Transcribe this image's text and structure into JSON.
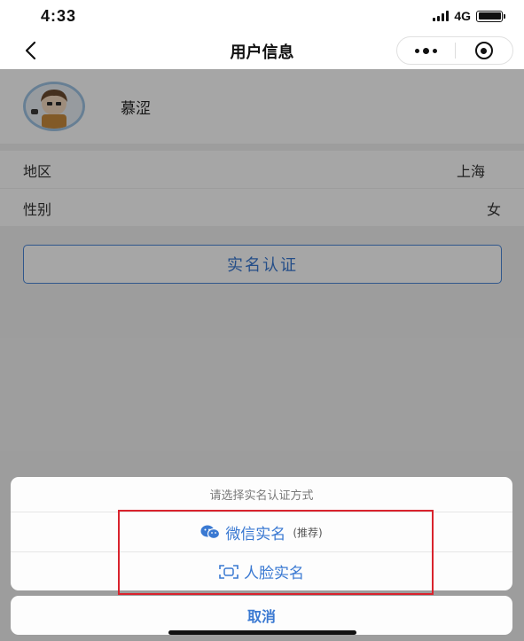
{
  "status_bar": {
    "time": "4:33",
    "network": "4G",
    "battery_level": 1.0
  },
  "nav": {
    "title": "用户信息",
    "back_icon": "chevron-left-icon",
    "more_icon": "more-dots-icon",
    "close_icon": "target-circle-icon"
  },
  "profile": {
    "nickname": "慕涩",
    "avatar_icon": "cartoon-avatar"
  },
  "info_rows": [
    {
      "label": "地区",
      "value": "上海"
    },
    {
      "label": "性别",
      "value": "女"
    }
  ],
  "verify_button": {
    "label": "实名认证"
  },
  "action_sheet": {
    "title": "请选择实名认证方式",
    "options": [
      {
        "label": "微信实名",
        "note": "(推荐)",
        "icon": "wechat-icon"
      },
      {
        "label": "人脸实名",
        "note": "",
        "icon": "face-scan-icon"
      }
    ],
    "cancel": "取消"
  },
  "colors": {
    "accent": "#3a79d2",
    "highlight": "#d9232d",
    "mask": "rgba(0,0,0,0.35)"
  }
}
